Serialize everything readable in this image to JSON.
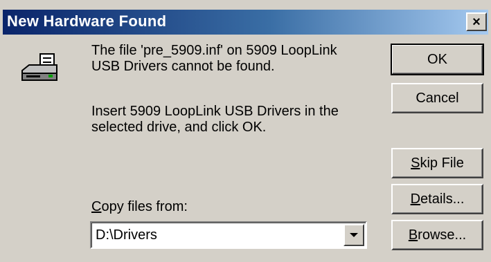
{
  "window": {
    "title": "New Hardware Found",
    "close_glyph": "×"
  },
  "message": {
    "line1": "The file 'pre_5909.inf' on 5909 LoopLink USB Drivers cannot be found.",
    "line2": "Insert 5909 LoopLink USB Drivers in the selected drive, and click OK."
  },
  "buttons": {
    "ok": "OK",
    "cancel": "Cancel",
    "skip_prefix": "S",
    "skip_rest": "kip File",
    "details_prefix": "D",
    "details_rest": "etails...",
    "browse_prefix": "B",
    "browse_rest": "rowse..."
  },
  "copy_from": {
    "label_prefix": "C",
    "label_rest": "opy files from:",
    "value": "D:\\Drivers"
  },
  "icons": {
    "drive": "disk-drive-icon",
    "close": "close-icon",
    "dropdown": "chevron-down-icon"
  }
}
